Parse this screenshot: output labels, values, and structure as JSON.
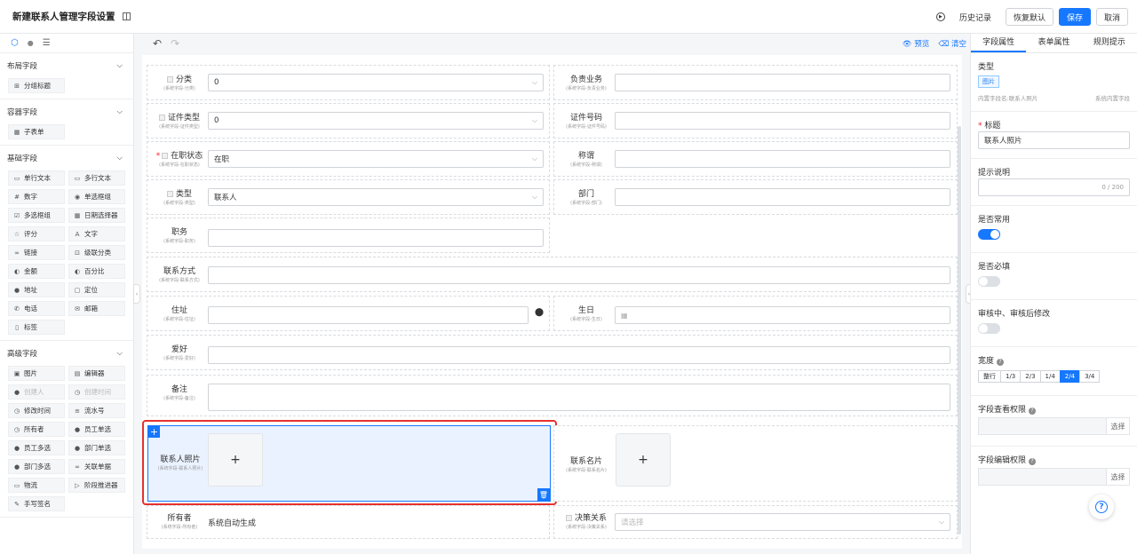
{
  "header": {
    "title": "新建联系人管理字段设置",
    "history": "历史记录",
    "restore": "恢复默认",
    "save": "保存",
    "cancel": "取消"
  },
  "left_panel": {
    "groups": [
      {
        "title": "布局字段",
        "items": [
          {
            "label": "分组标题",
            "icon": "group-icon"
          }
        ]
      },
      {
        "title": "容器字段",
        "items": [
          {
            "label": "子表单",
            "icon": "table-icon"
          }
        ]
      },
      {
        "title": "基础字段",
        "items": [
          {
            "label": "单行文本",
            "icon": "single-line-icon"
          },
          {
            "label": "多行文本",
            "icon": "multi-line-icon"
          },
          {
            "label": "数字",
            "icon": "number-icon"
          },
          {
            "label": "单选框组",
            "icon": "radio-icon"
          },
          {
            "label": "多选框组",
            "icon": "checkbox-icon"
          },
          {
            "label": "日期选择器",
            "icon": "calendar-icon"
          },
          {
            "label": "评分",
            "icon": "star-icon"
          },
          {
            "label": "文字",
            "icon": "text-icon"
          },
          {
            "label": "链接",
            "icon": "link-icon"
          },
          {
            "label": "级联分类",
            "icon": "cascade-icon"
          },
          {
            "label": "金额",
            "icon": "money-icon"
          },
          {
            "label": "百分比",
            "icon": "percent-icon"
          },
          {
            "label": "地址",
            "icon": "location-icon"
          },
          {
            "label": "定位",
            "icon": "locate-icon"
          },
          {
            "label": "电话",
            "icon": "phone-icon"
          },
          {
            "label": "邮箱",
            "icon": "mail-icon"
          },
          {
            "label": "标签",
            "icon": "tag-icon"
          }
        ]
      },
      {
        "title": "高级字段",
        "items": [
          {
            "label": "图片",
            "icon": "image-icon"
          },
          {
            "label": "编辑器",
            "icon": "editor-icon"
          },
          {
            "label": "创建人",
            "icon": "user-icon",
            "disabled": true
          },
          {
            "label": "创建时间",
            "icon": "clock-icon",
            "disabled": true
          },
          {
            "label": "修改时间",
            "icon": "clock-icon"
          },
          {
            "label": "流水号",
            "icon": "serial-icon"
          },
          {
            "label": "所有者",
            "icon": "clock-icon"
          },
          {
            "label": "员工单选",
            "icon": "user-icon"
          },
          {
            "label": "员工多选",
            "icon": "users-icon"
          },
          {
            "label": "部门单选",
            "icon": "dept-icon"
          },
          {
            "label": "部门多选",
            "icon": "dept-icon"
          },
          {
            "label": "关联单据",
            "icon": "link-doc-icon"
          },
          {
            "label": "物流",
            "icon": "truck-icon"
          },
          {
            "label": "阶段推进器",
            "icon": "stage-icon"
          },
          {
            "label": "手写签名",
            "icon": "sign-icon"
          }
        ]
      }
    ]
  },
  "toolbar": {
    "preview": "预览",
    "clear": "清空"
  },
  "form": {
    "category": {
      "label": "分类",
      "sub": "(系统字段-分类)",
      "value": "0"
    },
    "business": {
      "label": "负责业务",
      "sub": "(系统字段-负责业务)"
    },
    "id_type": {
      "label": "证件类型",
      "sub": "(系统字段-证件类型)",
      "value": "0"
    },
    "id_number": {
      "label": "证件号码",
      "sub": "(系统字段-证件号码)"
    },
    "status": {
      "label": "在职状态",
      "sub": "(系统字段-在职状态)",
      "value": "在职"
    },
    "title_name": {
      "label": "称谓",
      "sub": "(系统字段-称谓)"
    },
    "type": {
      "label": "类型",
      "sub": "(系统字段-类型)",
      "value": "联系人"
    },
    "dept": {
      "label": "部门",
      "sub": "(系统字段-部门)"
    },
    "job": {
      "label": "职务",
      "sub": "(系统字段-职务)"
    },
    "contact": {
      "label": "联系方式",
      "sub": "(系统字段-联系方式)"
    },
    "address": {
      "label": "住址",
      "sub": "(系统字段-住址)"
    },
    "birthday": {
      "label": "生日",
      "sub": "(系统字段-生日)"
    },
    "hobby": {
      "label": "爱好",
      "sub": "(系统字段-爱好)"
    },
    "remark": {
      "label": "备注",
      "sub": "(系统字段-备注)"
    },
    "photo": {
      "label": "联系人照片",
      "sub": "(系统字段-联系人照片)"
    },
    "card": {
      "label": "联系名片",
      "sub": "(系统字段-联系名片)"
    },
    "owner": {
      "label": "所有者",
      "sub": "(系统字段-所有者)",
      "value": "系统自动生成"
    },
    "decision": {
      "label": "决策关系",
      "sub": "(系统字段-决策关系)",
      "placeholder": "请选择"
    }
  },
  "right_panel": {
    "tabs": [
      "字段属性",
      "表单属性",
      "规则提示"
    ],
    "type_label": "类型",
    "type_badge": "图片",
    "builtin_name": "内置字段名:联系人照片",
    "builtin_kind": "系统内置字段",
    "title_label": "标题",
    "title_value": "联系人照片",
    "hint_label": "提示说明",
    "hint_count": "0 / 200",
    "common_label": "是否常用",
    "common_on": true,
    "required_label": "是否必填",
    "required_on": false,
    "review_label": "审核中、审核后修改",
    "review_on": false,
    "width_label": "宽度",
    "width_options": [
      "整行",
      "1/3",
      "2/3",
      "1/4",
      "2/4",
      "3/4"
    ],
    "width_selected": "2/4",
    "view_perm_label": "字段查看权限",
    "edit_perm_label": "字段编辑权限",
    "select": "选择"
  }
}
